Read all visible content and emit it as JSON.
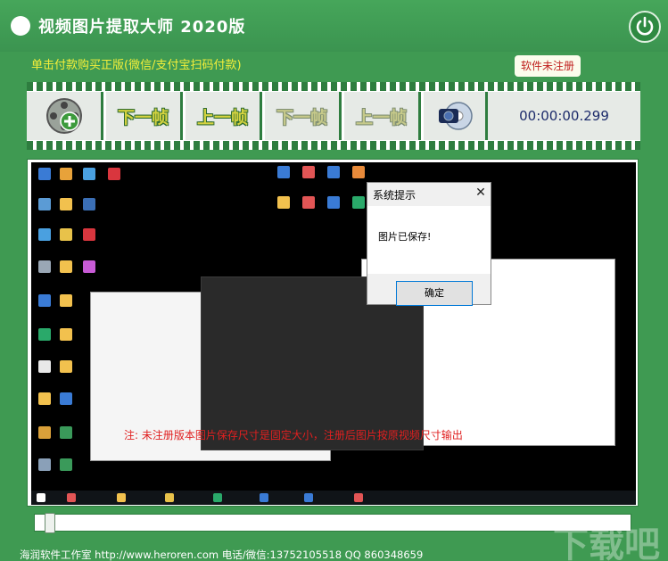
{
  "app": {
    "title": "视频图片提取大师  2020版"
  },
  "top": {
    "buy_link": "单击付款购买正版(微信/支付宝扫码付款)",
    "register_badge": "软件未注册"
  },
  "toolbar": {
    "add_icon": "add-film-icon",
    "next_frame_label": "下一帧",
    "prev_frame_label": "上一帧",
    "next_frame_label_2": "下一帧",
    "prev_frame_label_2": "上一帧",
    "capture_icon": "camera-disc-icon",
    "timecode": "00:00:00.299"
  },
  "preview": {
    "dialog": {
      "title": "系统提示",
      "message": "图片已保存!",
      "ok_label": "确定"
    },
    "notice": "注: 未注册版本图片保存尺寸是固定大小，注册后图片按原视频尺寸输出"
  },
  "seek": {
    "progress": 0.02
  },
  "footer": {
    "text": "海润软件工作室 http://www.heroren.com 电话/微信:13752105518  QQ 860348659"
  },
  "colors": {
    "background": "#3f9a52",
    "accent_yellow": "#f4ef3a",
    "film_green": "#2e7d3f",
    "notice_red": "#e02020"
  }
}
